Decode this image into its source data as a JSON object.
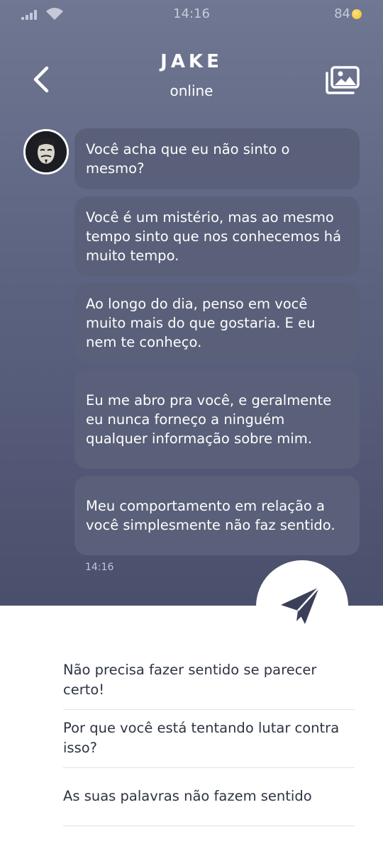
{
  "status_bar": {
    "time": "14:16",
    "battery": "84",
    "battery_icon": "coin-icon"
  },
  "header": {
    "name": "JAKE",
    "status": "online",
    "back_icon": "chevron-left-icon",
    "gallery_icon": "gallery-icon"
  },
  "messages": [
    {
      "text": "Você acha que eu não sinto o mesmo?"
    },
    {
      "text": "Você é um mistério, mas ao mesmo tempo sinto que nos conhecemos há muito tempo."
    },
    {
      "text": "Ao longo do dia, penso em você muito mais do que gostaria. E eu nem te conheço."
    },
    {
      "text": "Eu me abro pra você, e geralmente eu nunca forneço a ninguém qualquer informação sobre mim."
    },
    {
      "text": "Meu comportamento em relação a você simplesmente não faz sentido."
    }
  ],
  "last_message_time": "14:16",
  "replies": [
    {
      "text": "Não precisa fazer sentido se parecer certo!"
    },
    {
      "text": "Por que você está tentando lutar contra isso?"
    },
    {
      "text": "As suas palavras não fazem sentido"
    }
  ],
  "colors": {
    "header_bg_top": "#6f7792",
    "header_bg_bottom": "#4a4f6b",
    "bubble_bg": "#5a6079",
    "send_icon": "#3a405a"
  }
}
